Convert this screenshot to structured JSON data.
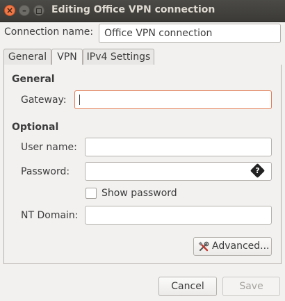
{
  "window": {
    "title": "Editing Office VPN connection",
    "close_glyph": "×",
    "minimize_glyph": "–"
  },
  "connection": {
    "name_label": "Connection name:",
    "name_value": "Office VPN connection"
  },
  "tabs": [
    {
      "label": "General",
      "active": false
    },
    {
      "label": "VPN",
      "active": true
    },
    {
      "label": "IPv4 Settings",
      "active": false
    }
  ],
  "vpn": {
    "general_heading": "General",
    "gateway_label": "Gateway:",
    "gateway_value": "",
    "optional_heading": "Optional",
    "username_label": "User name:",
    "username_value": "",
    "password_label": "Password:",
    "password_value": "",
    "password_icon_glyph": "?",
    "show_password_label": "Show password",
    "show_password_checked": false,
    "ntdomain_label": "NT Domain:",
    "ntdomain_value": "",
    "advanced_label": "Advanced..."
  },
  "footer": {
    "cancel_label": "Cancel",
    "save_label": "Save"
  },
  "colors": {
    "titlebar": "#3c3b37",
    "close_button": "#f07746",
    "focus_border": "#e27a53",
    "window_bg": "#f2f1f0"
  },
  "icons": {
    "close": "close-icon",
    "minimize": "minimize-icon",
    "maximize": "maximize-icon",
    "password_menu": "password-menu-icon",
    "advanced": "tools-icon"
  }
}
